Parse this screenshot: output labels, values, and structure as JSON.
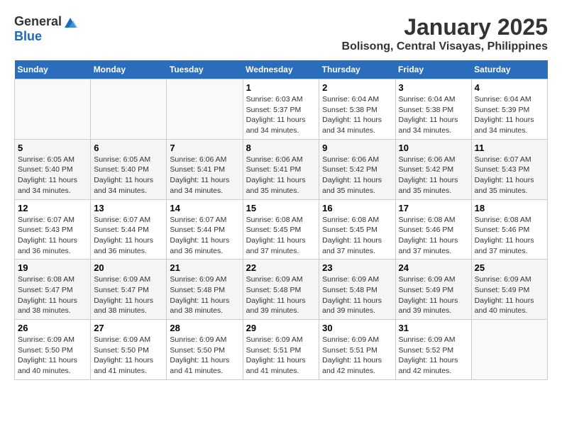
{
  "header": {
    "logo_general": "General",
    "logo_blue": "Blue",
    "title": "January 2025",
    "subtitle": "Bolisong, Central Visayas, Philippines"
  },
  "days_of_week": [
    "Sunday",
    "Monday",
    "Tuesday",
    "Wednesday",
    "Thursday",
    "Friday",
    "Saturday"
  ],
  "weeks": [
    {
      "days": [
        {
          "number": "",
          "info": "",
          "empty": true
        },
        {
          "number": "",
          "info": "",
          "empty": true
        },
        {
          "number": "",
          "info": "",
          "empty": true
        },
        {
          "number": "1",
          "info": "Sunrise: 6:03 AM\nSunset: 5:37 PM\nDaylight: 11 hours and 34 minutes.",
          "empty": false
        },
        {
          "number": "2",
          "info": "Sunrise: 6:04 AM\nSunset: 5:38 PM\nDaylight: 11 hours and 34 minutes.",
          "empty": false
        },
        {
          "number": "3",
          "info": "Sunrise: 6:04 AM\nSunset: 5:38 PM\nDaylight: 11 hours and 34 minutes.",
          "empty": false
        },
        {
          "number": "4",
          "info": "Sunrise: 6:04 AM\nSunset: 5:39 PM\nDaylight: 11 hours and 34 minutes.",
          "empty": false
        }
      ]
    },
    {
      "days": [
        {
          "number": "5",
          "info": "Sunrise: 6:05 AM\nSunset: 5:40 PM\nDaylight: 11 hours and 34 minutes.",
          "empty": false
        },
        {
          "number": "6",
          "info": "Sunrise: 6:05 AM\nSunset: 5:40 PM\nDaylight: 11 hours and 34 minutes.",
          "empty": false
        },
        {
          "number": "7",
          "info": "Sunrise: 6:06 AM\nSunset: 5:41 PM\nDaylight: 11 hours and 34 minutes.",
          "empty": false
        },
        {
          "number": "8",
          "info": "Sunrise: 6:06 AM\nSunset: 5:41 PM\nDaylight: 11 hours and 35 minutes.",
          "empty": false
        },
        {
          "number": "9",
          "info": "Sunrise: 6:06 AM\nSunset: 5:42 PM\nDaylight: 11 hours and 35 minutes.",
          "empty": false
        },
        {
          "number": "10",
          "info": "Sunrise: 6:06 AM\nSunset: 5:42 PM\nDaylight: 11 hours and 35 minutes.",
          "empty": false
        },
        {
          "number": "11",
          "info": "Sunrise: 6:07 AM\nSunset: 5:43 PM\nDaylight: 11 hours and 35 minutes.",
          "empty": false
        }
      ]
    },
    {
      "days": [
        {
          "number": "12",
          "info": "Sunrise: 6:07 AM\nSunset: 5:43 PM\nDaylight: 11 hours and 36 minutes.",
          "empty": false
        },
        {
          "number": "13",
          "info": "Sunrise: 6:07 AM\nSunset: 5:44 PM\nDaylight: 11 hours and 36 minutes.",
          "empty": false
        },
        {
          "number": "14",
          "info": "Sunrise: 6:07 AM\nSunset: 5:44 PM\nDaylight: 11 hours and 36 minutes.",
          "empty": false
        },
        {
          "number": "15",
          "info": "Sunrise: 6:08 AM\nSunset: 5:45 PM\nDaylight: 11 hours and 37 minutes.",
          "empty": false
        },
        {
          "number": "16",
          "info": "Sunrise: 6:08 AM\nSunset: 5:45 PM\nDaylight: 11 hours and 37 minutes.",
          "empty": false
        },
        {
          "number": "17",
          "info": "Sunrise: 6:08 AM\nSunset: 5:46 PM\nDaylight: 11 hours and 37 minutes.",
          "empty": false
        },
        {
          "number": "18",
          "info": "Sunrise: 6:08 AM\nSunset: 5:46 PM\nDaylight: 11 hours and 37 minutes.",
          "empty": false
        }
      ]
    },
    {
      "days": [
        {
          "number": "19",
          "info": "Sunrise: 6:08 AM\nSunset: 5:47 PM\nDaylight: 11 hours and 38 minutes.",
          "empty": false
        },
        {
          "number": "20",
          "info": "Sunrise: 6:09 AM\nSunset: 5:47 PM\nDaylight: 11 hours and 38 minutes.",
          "empty": false
        },
        {
          "number": "21",
          "info": "Sunrise: 6:09 AM\nSunset: 5:48 PM\nDaylight: 11 hours and 38 minutes.",
          "empty": false
        },
        {
          "number": "22",
          "info": "Sunrise: 6:09 AM\nSunset: 5:48 PM\nDaylight: 11 hours and 39 minutes.",
          "empty": false
        },
        {
          "number": "23",
          "info": "Sunrise: 6:09 AM\nSunset: 5:48 PM\nDaylight: 11 hours and 39 minutes.",
          "empty": false
        },
        {
          "number": "24",
          "info": "Sunrise: 6:09 AM\nSunset: 5:49 PM\nDaylight: 11 hours and 39 minutes.",
          "empty": false
        },
        {
          "number": "25",
          "info": "Sunrise: 6:09 AM\nSunset: 5:49 PM\nDaylight: 11 hours and 40 minutes.",
          "empty": false
        }
      ]
    },
    {
      "days": [
        {
          "number": "26",
          "info": "Sunrise: 6:09 AM\nSunset: 5:50 PM\nDaylight: 11 hours and 40 minutes.",
          "empty": false
        },
        {
          "number": "27",
          "info": "Sunrise: 6:09 AM\nSunset: 5:50 PM\nDaylight: 11 hours and 41 minutes.",
          "empty": false
        },
        {
          "number": "28",
          "info": "Sunrise: 6:09 AM\nSunset: 5:50 PM\nDaylight: 11 hours and 41 minutes.",
          "empty": false
        },
        {
          "number": "29",
          "info": "Sunrise: 6:09 AM\nSunset: 5:51 PM\nDaylight: 11 hours and 41 minutes.",
          "empty": false
        },
        {
          "number": "30",
          "info": "Sunrise: 6:09 AM\nSunset: 5:51 PM\nDaylight: 11 hours and 42 minutes.",
          "empty": false
        },
        {
          "number": "31",
          "info": "Sunrise: 6:09 AM\nSunset: 5:52 PM\nDaylight: 11 hours and 42 minutes.",
          "empty": false
        },
        {
          "number": "",
          "info": "",
          "empty": true
        }
      ]
    }
  ]
}
